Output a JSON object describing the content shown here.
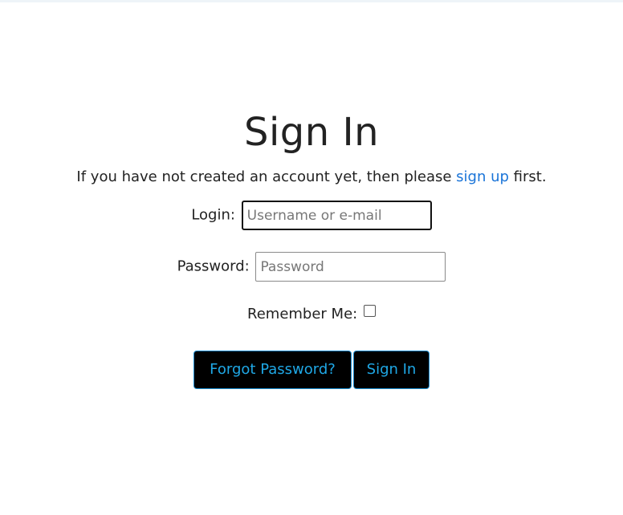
{
  "page": {
    "title": "Sign In",
    "intro_prefix": "If you have not created an account yet, then please ",
    "intro_link": "sign up",
    "intro_suffix": " first."
  },
  "form": {
    "login_label": "Login:",
    "login_placeholder": "Username or e-mail",
    "password_label": "Password:",
    "password_placeholder": "Password",
    "remember_label": "Remember Me:",
    "remember_checked": false
  },
  "buttons": {
    "forgot_label": "Forgot Password?",
    "signin_label": "Sign In"
  },
  "colors": {
    "link": "#1a74d8",
    "button_bg": "#000000",
    "button_text": "#1fa8e6"
  }
}
